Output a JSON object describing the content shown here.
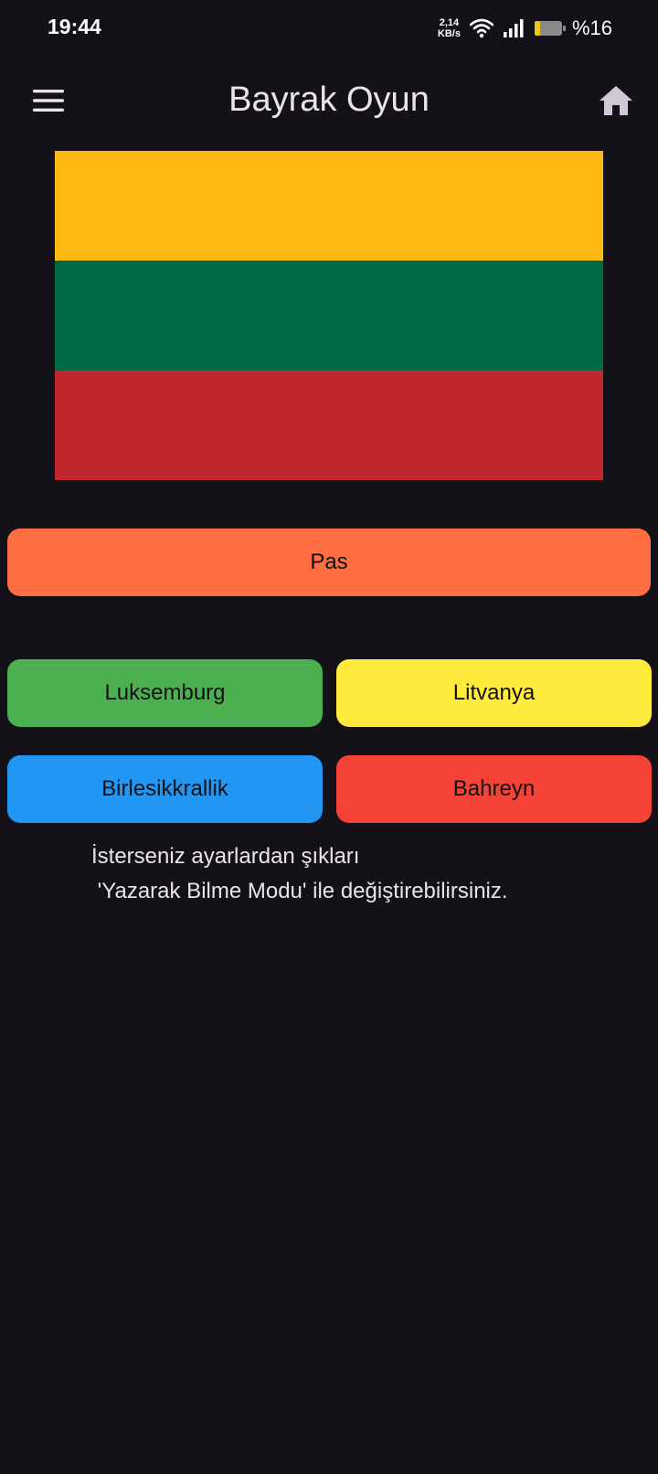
{
  "status_bar": {
    "time": "19:44",
    "net_speed_value": "2,14",
    "net_speed_unit": "KB/s",
    "battery_percent": "%16",
    "wifi_icon": "wifi-icon",
    "signal_icon": "signal-icon",
    "battery_icon": "battery-icon"
  },
  "app_bar": {
    "title": "Bayrak Oyun",
    "menu_icon": "menu-icon",
    "home_icon": "home-icon"
  },
  "flag": {
    "stripes": [
      "#FDB913",
      "#006A44",
      "#C1272D"
    ]
  },
  "actions": {
    "pass_label": "Pas",
    "pass_color": "#FF6F42"
  },
  "options": [
    {
      "label": "Luksemburg",
      "color": "#4CAF50"
    },
    {
      "label": "Litvanya",
      "color": "#FFEB3B"
    },
    {
      "label": "Birlesikkrallik",
      "color": "#2196F3"
    },
    {
      "label": "Bahreyn",
      "color": "#F44336"
    }
  ],
  "hint": {
    "line1": "İsterseniz ayarlardan şıkları",
    "line2": " 'Yazarak Bilme Modu' ile değiştirebilirsiniz."
  }
}
